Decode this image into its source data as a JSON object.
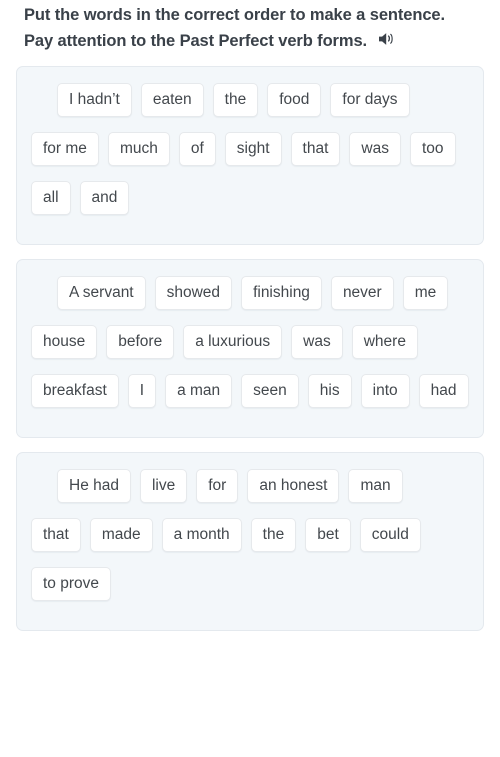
{
  "prompt": {
    "text": "Put the words in the correct order to make a sentence. Pay attention to the Past Perfect verb forms.",
    "audio_icon": "speaker-icon"
  },
  "colors": {
    "page_background": "#ffffff",
    "card_background": "#f3f7fa",
    "card_border": "#e4e9ee",
    "chip_background": "#ffffff",
    "chip_border": "#e6e9ec",
    "chip_text": "#43484d",
    "prompt_text": "#3a4149"
  },
  "exercises": [
    {
      "id": "sentence-1",
      "words": [
        "I hadn’t",
        "eaten",
        "the",
        "food",
        "for days",
        "for me",
        "much",
        "of",
        "sight",
        "that",
        "was",
        "too",
        "all",
        "and"
      ]
    },
    {
      "id": "sentence-2",
      "words": [
        "A servant",
        "showed",
        "finishing",
        "never",
        "me",
        "house",
        "before",
        "a luxurious",
        "was",
        "where",
        "breakfast",
        "I",
        "a man",
        "seen",
        "his",
        "into",
        "had"
      ]
    },
    {
      "id": "sentence-3",
      "words": [
        "He had",
        "live",
        "for",
        "an honest",
        "man",
        "that",
        "made",
        "a month",
        "the",
        "bet",
        "could",
        "to prove"
      ]
    }
  ]
}
